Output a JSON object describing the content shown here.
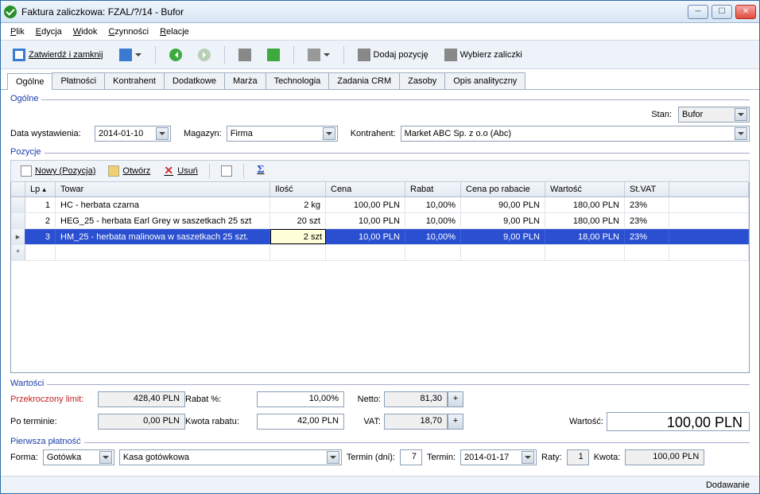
{
  "window": {
    "title": "Faktura zaliczkowa: FZAL/?/14 - Bufor"
  },
  "menu": {
    "plik": "Plik",
    "edycja": "Edycja",
    "widok": "Widok",
    "czynnosci": "Czynności",
    "relacje": "Relacje"
  },
  "toolbar": {
    "zatwierdz": "Zatwierdź i zamknij",
    "dodaj": "Dodaj pozycję",
    "wybierz": "Wybierz zaliczki"
  },
  "tabs": [
    "Ogólne",
    "Płatności",
    "Kontrahent",
    "Dodatkowe",
    "Marża",
    "Technologia",
    "Zadania CRM",
    "Zasoby",
    "Opis analityczny"
  ],
  "ogolne": {
    "legend": "Ogólne",
    "stan_label": "Stan:",
    "stan_value": "Bufor",
    "data_label": "Data wystawienia:",
    "data_value": "2014-01-10",
    "magazyn_label": "Magazyn:",
    "magazyn_value": "Firma",
    "kontrahent_label": "Kontrahent:",
    "kontrahent_value": "Market ABC Sp. z o.o (Abc)"
  },
  "pozycje": {
    "legend": "Pozycje",
    "nowy": "Nowy (Pozycja)",
    "otworz": "Otwórz",
    "usun": "Usuń",
    "cols": {
      "lp": "Lp",
      "towar": "Towar",
      "ilosc": "Ilość",
      "cena": "Cena",
      "rabat": "Rabat",
      "cpr": "Cena po rabacie",
      "wartosc": "Wartość",
      "stvat": "St.VAT"
    },
    "rows": [
      {
        "lp": "1",
        "towar": "HC - herbata czarna",
        "ilosc": "2 kg",
        "cena": "100,00 PLN",
        "rabat": "10,00%",
        "cpr": "90,00 PLN",
        "wartosc": "180,00 PLN",
        "stvat": "23%"
      },
      {
        "lp": "2",
        "towar": "HEG_25 - herbata Earl Grey w saszetkach 25 szt",
        "ilosc": "20 szt",
        "cena": "10,00 PLN",
        "rabat": "10,00%",
        "cpr": "9,00 PLN",
        "wartosc": "180,00 PLN",
        "stvat": "23%"
      },
      {
        "lp": "3",
        "towar": "HM_25 - herbata malinowa w saszetkach 25 szt.",
        "ilosc": "2 szt",
        "cena": "10,00 PLN",
        "rabat": "10,00%",
        "cpr": "9,00 PLN",
        "wartosc": "18,00 PLN",
        "stvat": "23%"
      }
    ]
  },
  "wartosci": {
    "legend": "Wartości",
    "przek_label": "Przekroczony limit:",
    "przek": "428,40 PLN",
    "rabatp_label": "Rabat %:",
    "rabatp": "10,00%",
    "netto_label": "Netto:",
    "netto": "81,30",
    "po_label": "Po terminie:",
    "po": "0,00 PLN",
    "kwotar_label": "Kwota rabatu:",
    "kwotar": "42,00 PLN",
    "vat_label": "VAT:",
    "vat": "18,70",
    "wartosc_label": "Wartość:",
    "wartosc": "100,00 PLN"
  },
  "platnosc": {
    "legend": "Pierwsza płatność",
    "forma_label": "Forma:",
    "forma": "Gotówka",
    "kasa": "Kasa gotówkowa",
    "termindni_label": "Termin (dni):",
    "termindni": "7",
    "termin_label": "Termin:",
    "termin": "2014-01-17",
    "raty_label": "Raty:",
    "raty": "1",
    "kwota_label": "Kwota:",
    "kwota": "100,00 PLN"
  },
  "status": {
    "text": "Dodawanie"
  }
}
